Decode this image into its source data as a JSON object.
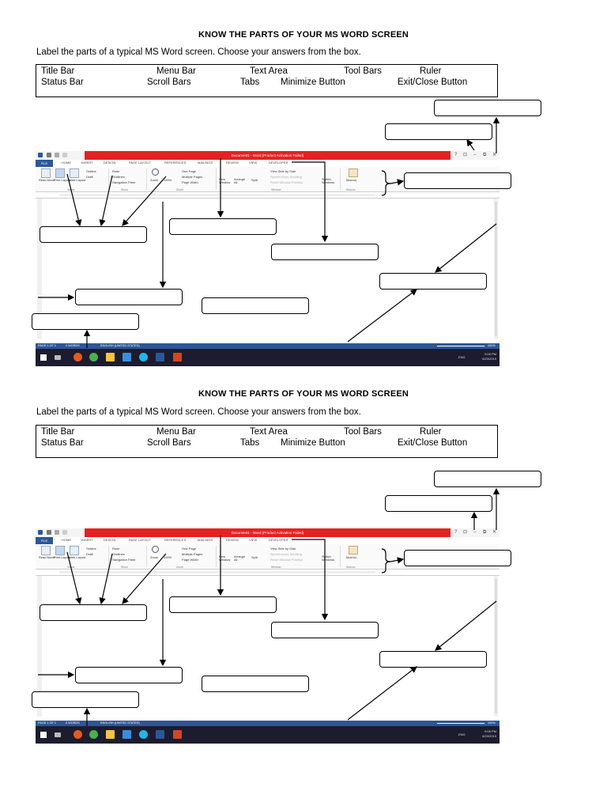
{
  "worksheets": [
    {
      "title": "KNOW THE PARTS OF YOUR MS WORD SCREEN",
      "instruction": "Label the parts of a typical MS Word screen. Choose your answers from the box.",
      "answer_box": [
        "Title Bar",
        "Menu Bar",
        "Text Area",
        "Tool Bars",
        "Ruler",
        "Status Bar",
        "Scroll Bars",
        "Tabs",
        "Minimize Button",
        "Exit/Close Button"
      ],
      "screenshot": {
        "title_bar_text": "Document1 - Word (Product Activation Failed)",
        "sign_in": "Sign in",
        "window_controls": [
          "?",
          "⊡",
          "–",
          "⧉",
          "✕"
        ],
        "tabs": [
          "FILE",
          "HOME",
          "INSERT",
          "DESIGN",
          "PAGE LAYOUT",
          "REFERENCES",
          "MAILINGS",
          "REVIEW",
          "VIEW",
          "DEVELOPER"
        ],
        "ribbon": {
          "views": [
            "Read Mode",
            "Print Layout",
            "Web Layout"
          ],
          "views_sub": [
            "Outline",
            "Draft"
          ],
          "views_group": "Views",
          "show": [
            "Ruler",
            "Gridlines",
            "Navigation Pane"
          ],
          "show_group": "Show",
          "zoom_items": [
            "Zoom",
            "100%",
            "One Page",
            "Multiple Pages",
            "Page Width"
          ],
          "zoom_group": "Zoom",
          "window_items": [
            "New Window",
            "Arrange All",
            "Split",
            "View Side by Side",
            "Synchronous Scrolling",
            "Reset Window Position",
            "Switch Windows"
          ],
          "window_group": "Window",
          "macros": "Macros",
          "macros_group": "Macros"
        },
        "status": [
          "PAGE 1 OF 1",
          "0 WORDS",
          "ENGLISH (UNITED STATES)"
        ],
        "zoom_pct": "100%",
        "clock_time": "9:08 PM",
        "clock_date": "6/23/2019",
        "lang": "ENG"
      }
    },
    {
      "title": "KNOW THE PARTS OF YOUR MS WORD SCREEN",
      "instruction": "Label the parts of a typical MS Word screen. Choose your answers from the box.",
      "answer_box": [
        "Title Bar",
        "Menu Bar",
        "Text Area",
        "Tool Bars",
        "Ruler",
        "Status Bar",
        "Scroll Bars",
        "Tabs",
        "Minimize Button",
        "Exit/Close Button"
      ],
      "screenshot": {
        "title_bar_text": "Document1 - Word (Product Activation Failed)",
        "sign_in": "Sign in",
        "window_controls": [
          "?",
          "⊡",
          "–",
          "⧉",
          "✕"
        ],
        "tabs": [
          "FILE",
          "HOME",
          "INSERT",
          "DESIGN",
          "PAGE LAYOUT",
          "REFERENCES",
          "MAILINGS",
          "REVIEW",
          "VIEW",
          "DEVELOPER"
        ],
        "ribbon": {
          "views": [
            "Read Mode",
            "Print Layout",
            "Web Layout"
          ],
          "views_sub": [
            "Outline",
            "Draft"
          ],
          "views_group": "Views",
          "show": [
            "Ruler",
            "Gridlines",
            "Navigation Pane"
          ],
          "show_group": "Show",
          "zoom_items": [
            "Zoom",
            "100%",
            "One Page",
            "Multiple Pages",
            "Page Width"
          ],
          "zoom_group": "Zoom",
          "window_items": [
            "New Window",
            "Arrange All",
            "Split",
            "View Side by Side",
            "Synchronous Scrolling",
            "Reset Window Position",
            "Switch Windows"
          ],
          "window_group": "Window",
          "macros": "Macros",
          "macros_group": "Macros"
        },
        "status": [
          "PAGE 1 OF 1",
          "0 WORDS",
          "ENGLISH (UNITED STATES)"
        ],
        "zoom_pct": "100%",
        "clock_time": "9:08 PM",
        "clock_date": "6/23/2019",
        "lang": "ENG"
      }
    }
  ]
}
